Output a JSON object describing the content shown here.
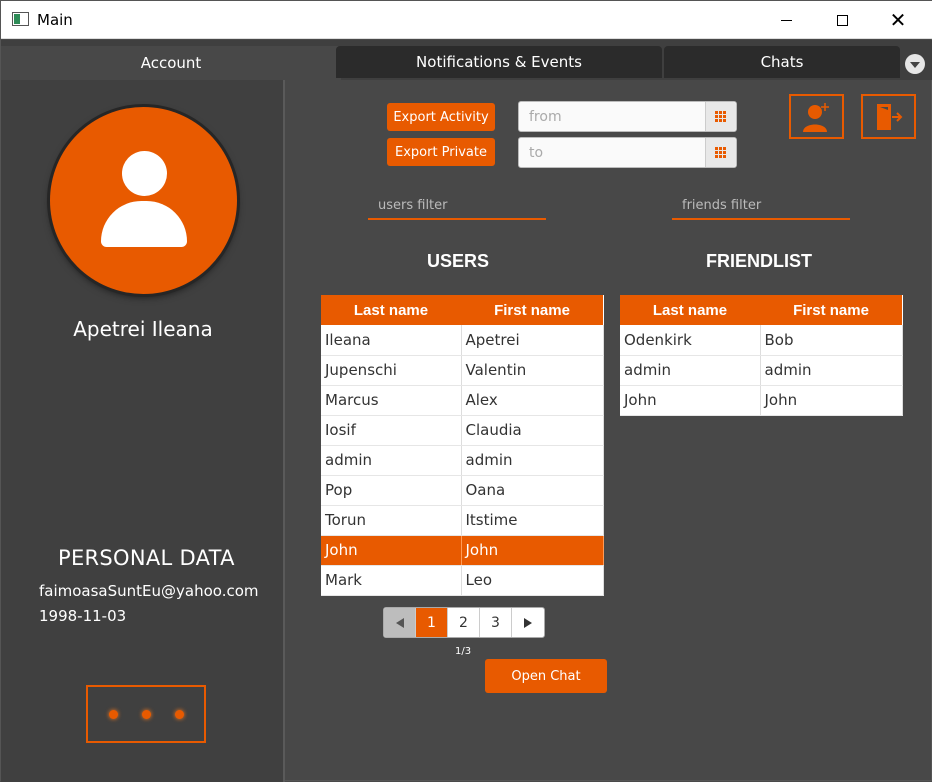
{
  "window": {
    "title": "Main"
  },
  "tabs": [
    {
      "label": "Account"
    },
    {
      "label": "Notifications & Events"
    },
    {
      "label": "Chats"
    }
  ],
  "profile": {
    "name": "Apetrei Ileana",
    "personal_data_title": "PERSONAL DATA",
    "email": "faimoasaSuntEu@yahoo.com",
    "birthdate": "1998-11-03"
  },
  "actions": {
    "export_activity": "Export Activity",
    "export_private": "Export Private",
    "from_placeholder": "from",
    "to_placeholder": "to",
    "add_friend_icon": "add-user-icon",
    "logout_icon": "logout-icon"
  },
  "filters": {
    "users_placeholder": "users filter",
    "friends_placeholder": "friends filter"
  },
  "users": {
    "title": "USERS",
    "columns": [
      "Last name",
      "First name"
    ],
    "rows": [
      [
        "Ileana",
        "Apetrei"
      ],
      [
        "Jupenschi",
        "Valentin"
      ],
      [
        "Marcus",
        "Alex"
      ],
      [
        "Iosif",
        "Claudia"
      ],
      [
        "admin",
        "admin"
      ],
      [
        "Pop",
        "Oana"
      ],
      [
        "Torun",
        "Itstime"
      ],
      [
        "John",
        "John"
      ],
      [
        "Mark",
        "Leo"
      ]
    ],
    "selected_row": 7
  },
  "friends": {
    "title": "FRIENDLIST",
    "columns": [
      "Last name",
      "First name"
    ],
    "rows": [
      [
        "Odenkirk",
        "Bob"
      ],
      [
        "admin",
        "admin"
      ],
      [
        "John",
        "John"
      ]
    ]
  },
  "pagination": {
    "pages": [
      "1",
      "2",
      "3"
    ],
    "current": "1",
    "info": "1/3"
  },
  "open_chat": "Open Chat",
  "colors": {
    "accent": "#e85a00",
    "background": "#484848",
    "sidebar": "#404040"
  }
}
